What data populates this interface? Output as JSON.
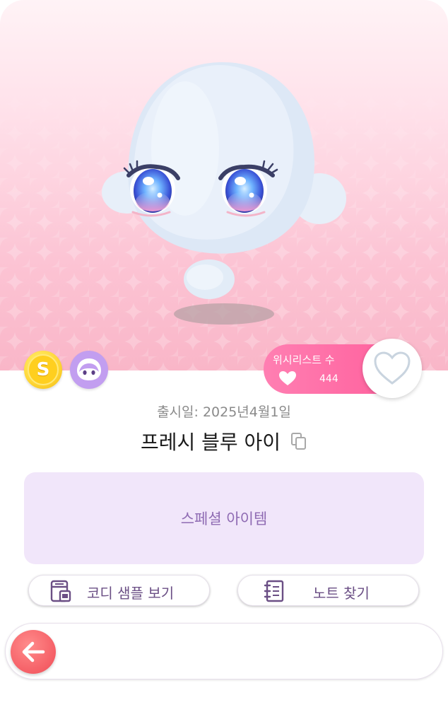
{
  "item": {
    "release_label": "출시일: 2025년4월1일",
    "name": "프레시 블루 아이",
    "category_label": "스페셜 아이템"
  },
  "wishlist": {
    "label": "위시리스트 수",
    "count": "444"
  },
  "badges": {
    "coin_letter": "S",
    "coin_icon": "coin-icon",
    "avatar_icon": "avatar-face-icon"
  },
  "actions": {
    "coordi_sample_label": "코디 샘플 보기",
    "note_search_label": "노트 찾기"
  },
  "colors": {
    "accent_pink": "#ff6aa5",
    "purple_text": "#8f6bb3",
    "special_bg": "#f1e6fa",
    "back_red": "#f55f66",
    "coin_gold": "#ffd83a",
    "avatar_purple": "#c29ef0"
  }
}
